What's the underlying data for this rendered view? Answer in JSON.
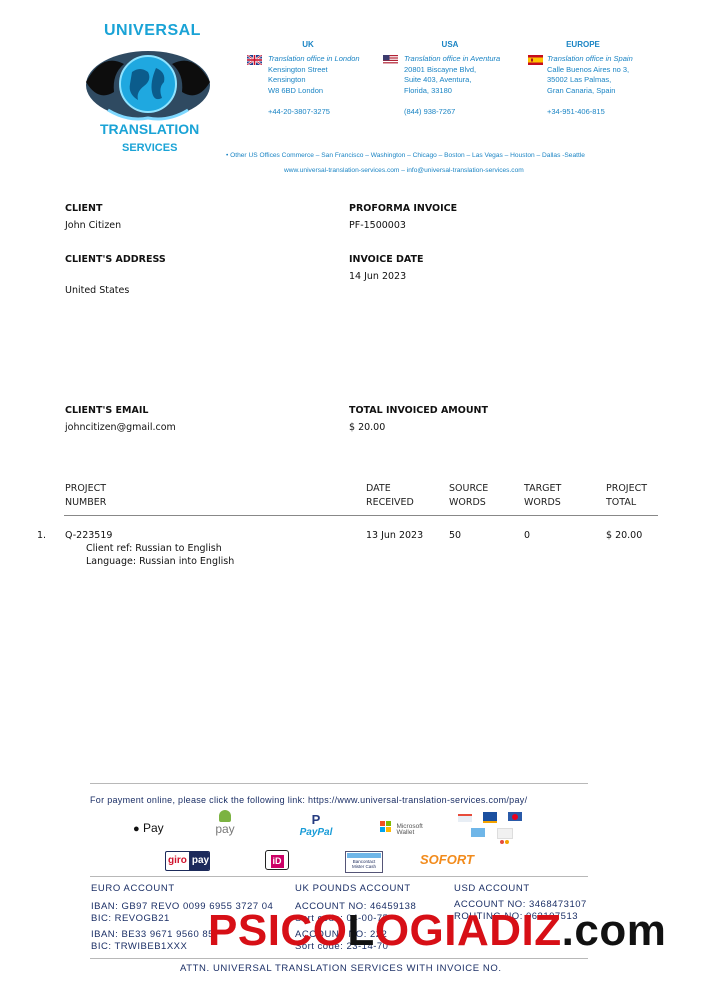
{
  "logo": {
    "top": "UNIVERSAL",
    "middle": "TRANSLATION",
    "bottom": "SERVICES"
  },
  "offices": [
    {
      "region": "UK",
      "lines": [
        "Translation office in London",
        "Kensington Street",
        "Kensington",
        "W8 6BD London"
      ],
      "phone": "+44-20-3807-3275",
      "flag": "uk-flag-icon"
    },
    {
      "region": "USA",
      "lines": [
        "Translation office in Aventura",
        "20801 Biscayne Blvd,",
        "Suite 403, Aventura,",
        "Florida, 33180"
      ],
      "phone": "(844) 938-7267",
      "flag": "usa-flag-icon"
    },
    {
      "region": "EUROPE",
      "lines": [
        "Translation office in Spain",
        "Calle Buenos Aires no 3,",
        "35002 Las Palmas,",
        "Gran Canaria, Spain"
      ],
      "phone": "+34-951-406-815",
      "flag": "spain-flag-icon"
    }
  ],
  "other_offices": "• Other US Offices Commerce – San Francisco – Washington – Chicago – Boston – Las Vegas – Houston – Dallas -Seattle",
  "web_line": "www.universal-translation-services.com – info@universal-translation-services.com",
  "client": {
    "label": "CLIENT",
    "value": "John Citizen"
  },
  "proforma": {
    "label": "PROFORMA INVOICE",
    "value": "PF-1500003"
  },
  "address": {
    "label": "CLIENT'S ADDRESS",
    "value": "United States"
  },
  "invoice_date": {
    "label": "INVOICE DATE",
    "value": "14 Jun 2023"
  },
  "email": {
    "label": "CLIENT'S EMAIL",
    "value": "johncitizen@gmail.com"
  },
  "total": {
    "label": "TOTAL INVOICED AMOUNT",
    "value": "$ 20.00"
  },
  "table": {
    "headers": [
      [
        "PROJECT",
        "NUMBER"
      ],
      [
        "DATE",
        "RECEIVED"
      ],
      [
        "SOURCE",
        "WORDS"
      ],
      [
        "TARGET",
        "WORDS"
      ],
      [
        "PROJECT",
        "TOTAL"
      ]
    ],
    "rows": [
      {
        "index": "1.",
        "project": "Q-223519",
        "details": [
          "Client ref: Russian to English",
          "Language: Russian into English"
        ],
        "date": "13 Jun 2023",
        "source": "50",
        "target": "0",
        "total": "$ 20.00"
      }
    ]
  },
  "footer": {
    "pay_link_text": "For payment online, please click the following link: https://www.universal-translation-services.com/pay/",
    "payment_methods": [
      "Apple Pay",
      "Android Pay",
      "PayPal",
      "Microsoft Wallet",
      "giropay",
      "iDEAL",
      "Bancontact Mister Cash",
      "SOFORT"
    ],
    "labels": {
      "apple": "Pay",
      "android": "pay",
      "paypal": "PayPal",
      "ms1": "Microsoft",
      "ms2": "Wallet",
      "giro": "giro",
      "giropay": "pay",
      "ideal": "iD",
      "bancontact1": "Bancontact",
      "bancontact2": "Mister Cash",
      "sofort": "SOFORT"
    },
    "accounts": [
      {
        "title": "EURO ACCOUNT",
        "lines": [
          "IBAN: GB97 REVO 0099 6955 3727 04",
          "BIC: REVOGB21",
          "IBAN: BE33 9671 9560 85",
          "BIC: TRWIBEB1XXX"
        ]
      },
      {
        "title": "UK POUNDS ACCOUNT",
        "lines": [
          "ACCOUNT NO: 46459138",
          "Sort code: 04-00-75",
          "ACCOUNT NO: 222",
          "Sort code: 23-14-70"
        ]
      },
      {
        "title": "USD ACCOUNT",
        "lines": [
          "ACCOUNT NO: 3468473107",
          "ROUTING NO: 063107513"
        ]
      }
    ],
    "attn": "ATTN. UNIVERSAL TRANSLATION SERVICES WITH INVOICE NO."
  },
  "watermark": {
    "red1": "PSICO",
    "black1": "L",
    "red2": "OGIADIZ",
    "black2": ".com"
  },
  "colors": {
    "brand_blue": "#1a84c4",
    "footer_navy": "#1b2f66",
    "watermark_red": "#d70f16"
  }
}
